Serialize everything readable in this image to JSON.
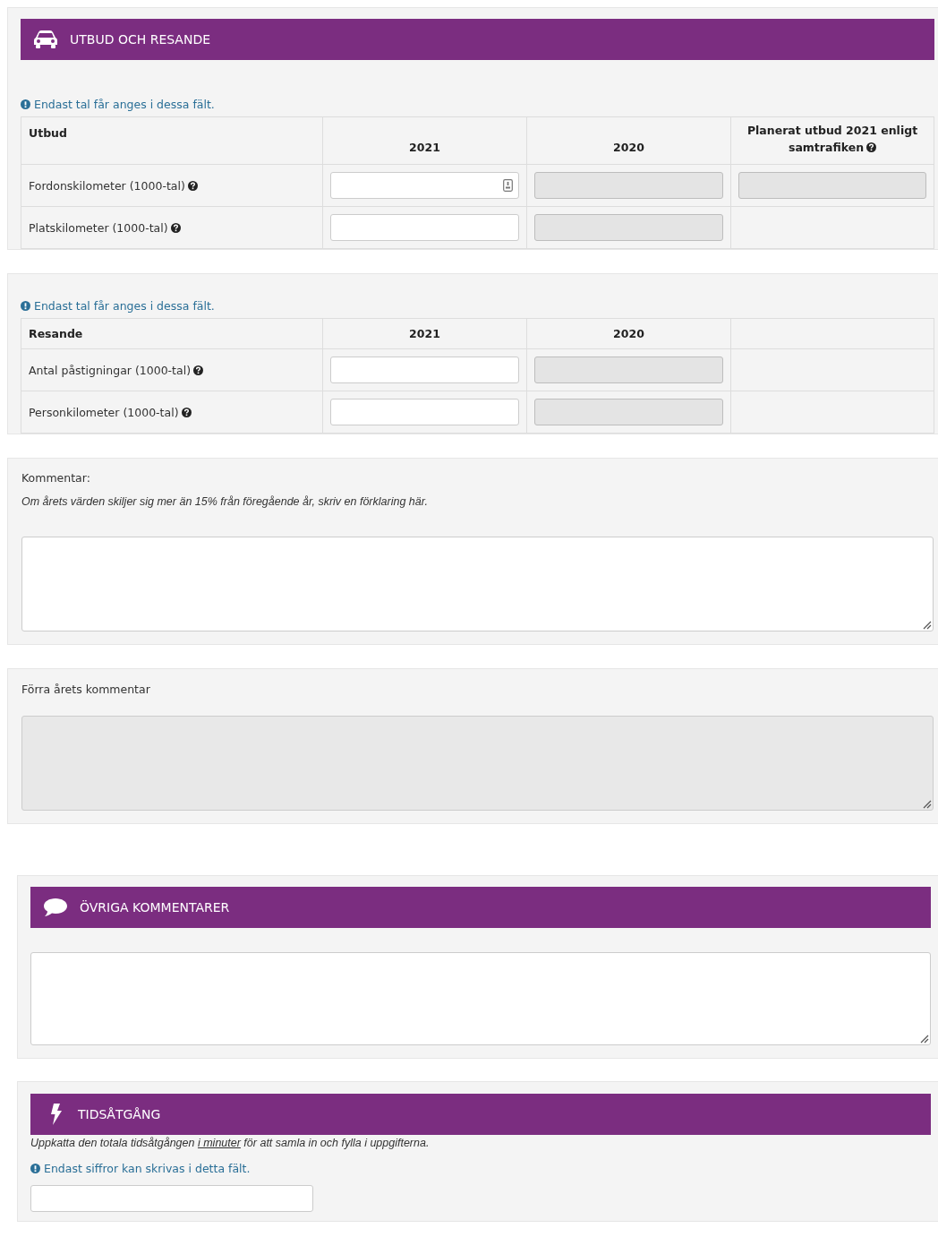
{
  "utbud_och_resande": {
    "title": "UTBUD OCH RESANDE",
    "tables": [
      {
        "info": "Endast tal får anges i dessa fält.",
        "columns": [
          {
            "label": "Utbud",
            "help": false
          },
          {
            "label": "2021",
            "help": false
          },
          {
            "label": "2020",
            "help": false
          },
          {
            "label": "Planerat utbud 2021 enligt samtrafiken",
            "help": true
          }
        ],
        "rows": [
          {
            "label": "Fordonskilometer (1000-tal)",
            "help": true,
            "fields": [
              {
                "disabled": false,
                "autofill_icon": true
              },
              {
                "disabled": true,
                "autofill_icon": false
              },
              {
                "disabled": true,
                "autofill_icon": false
              }
            ]
          },
          {
            "label": "Platskilometer (1000-tal)",
            "help": true,
            "fields": [
              {
                "disabled": false,
                "autofill_icon": false
              },
              {
                "disabled": true,
                "autofill_icon": false
              }
            ]
          }
        ]
      },
      {
        "info": "Endast tal får anges i dessa fält.",
        "columns": [
          {
            "label": "Resande",
            "help": false
          },
          {
            "label": "2021",
            "help": false
          },
          {
            "label": "2020",
            "help": false
          }
        ],
        "rows": [
          {
            "label": "Antal påstigningar (1000-tal)",
            "help": true,
            "fields": [
              {
                "disabled": false,
                "autofill_icon": false
              },
              {
                "disabled": true,
                "autofill_icon": false
              }
            ]
          },
          {
            "label": "Personkilometer (1000-tal)",
            "help": true,
            "fields": [
              {
                "disabled": false,
                "autofill_icon": false
              },
              {
                "disabled": true,
                "autofill_icon": false
              }
            ]
          }
        ]
      }
    ],
    "comment": {
      "label": "Kommentar:",
      "hint": "Om årets värden skiljer sig mer än 15% från föregående år, skriv en förklaring här.",
      "disabled": false
    },
    "previous_comment": {
      "label": "Förra årets kommentar",
      "disabled": true
    }
  },
  "ovriga_kommentarer": {
    "title": "ÖVRIGA KOMMENTARER"
  },
  "tidsatgang": {
    "title": "TIDSÅTGÅNG",
    "instruction": {
      "before": "Uppkatta den totala tidsåtgången ",
      "underlined": "i minuter",
      "after": " för att samla in och fylla i uppgifterna."
    },
    "info": "Endast siffror kan skrivas i detta fält."
  }
}
